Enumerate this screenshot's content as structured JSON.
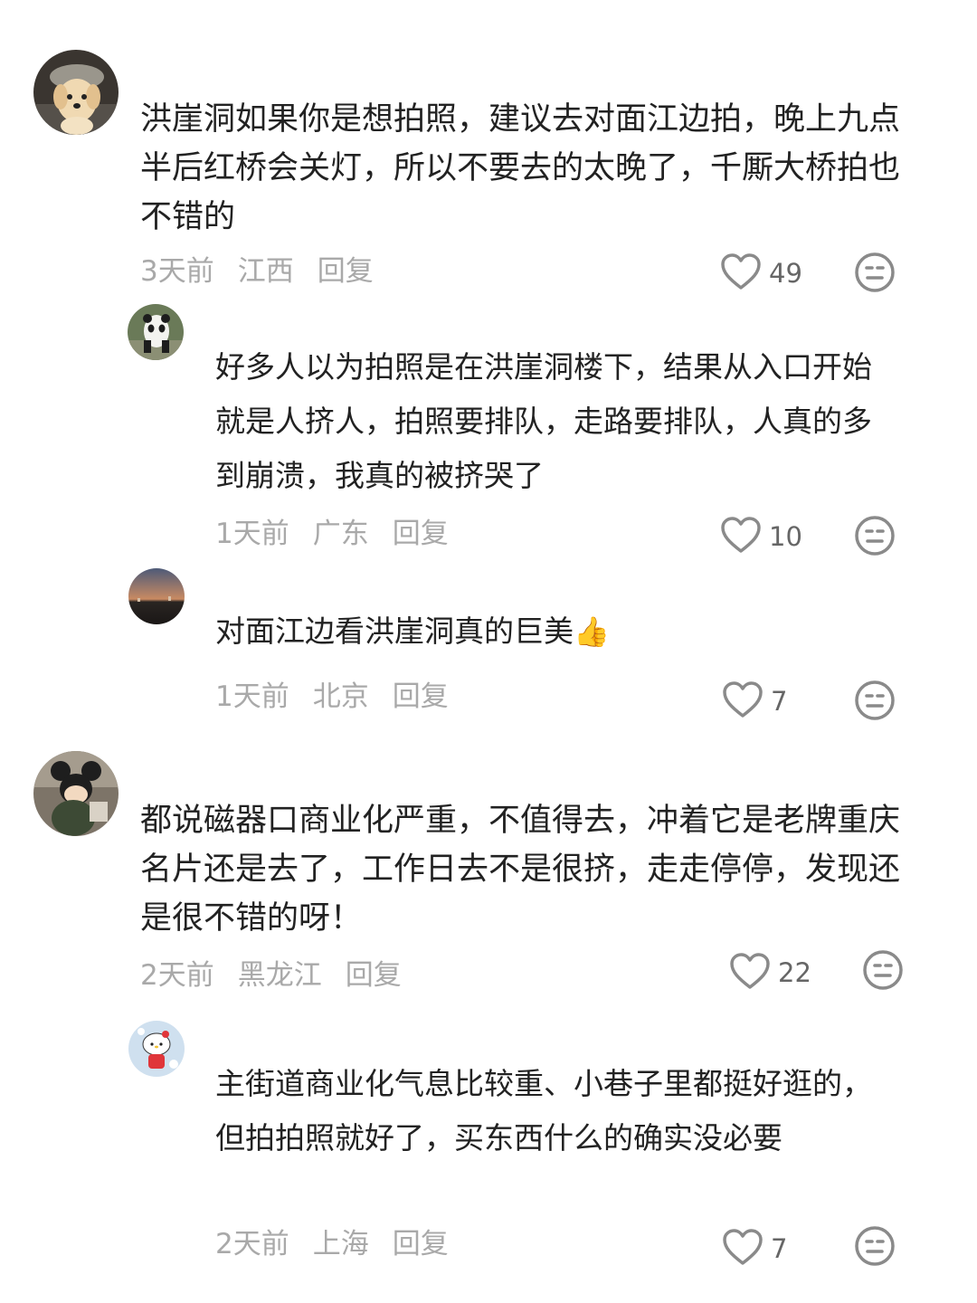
{
  "comments": [
    {
      "text": "洪崖洞如果你是想拍照，建议去对面江边拍，晚上九点半后红桥会关灯，所以不要去的太晚了，千厮大桥拍也不错的",
      "time": "3天前",
      "location": "江西",
      "reply_label": "回复",
      "likes": "49",
      "avatar_icon": "dog-avatar",
      "replies": [
        {
          "text": "好多人以为拍照是在洪崖洞楼下，结果从入口开始就是人挤人，拍照要排队，走路要排队，人真的多到崩溃，我真的被挤哭了",
          "time": "1天前",
          "location": "广东",
          "reply_label": "回复",
          "likes": "10",
          "avatar_icon": "panda-avatar"
        },
        {
          "text": "对面江边看洪崖洞真的巨美",
          "emoji": "👍",
          "time": "1天前",
          "location": "北京",
          "reply_label": "回复",
          "likes": "7",
          "avatar_icon": "sunset-avatar"
        }
      ]
    },
    {
      "text": "都说磁器口商业化严重，不值得去，冲着它是老牌重庆名片还是去了，工作日去不是很挤，走走停停，发现还是很不错的呀！",
      "time": "2天前",
      "location": "黑龙江",
      "reply_label": "回复",
      "likes": "22",
      "avatar_icon": "mickey-avatar",
      "replies": [
        {
          "text": "主街道商业化气息比较重、小巷子里都挺好逛的，但拍拍照就好了，买东西什么的确实没必要",
          "time": "2天前",
          "location": "上海",
          "reply_label": "回复",
          "likes": "7",
          "avatar_icon": "hello-kitty-avatar"
        }
      ]
    }
  ],
  "colors": {
    "text": "#222222",
    "meta": "#a9a9a9",
    "icon": "#8a8a8a"
  },
  "icons": {
    "like": "heart-outline-icon",
    "emoji": "neutral-face-icon"
  }
}
